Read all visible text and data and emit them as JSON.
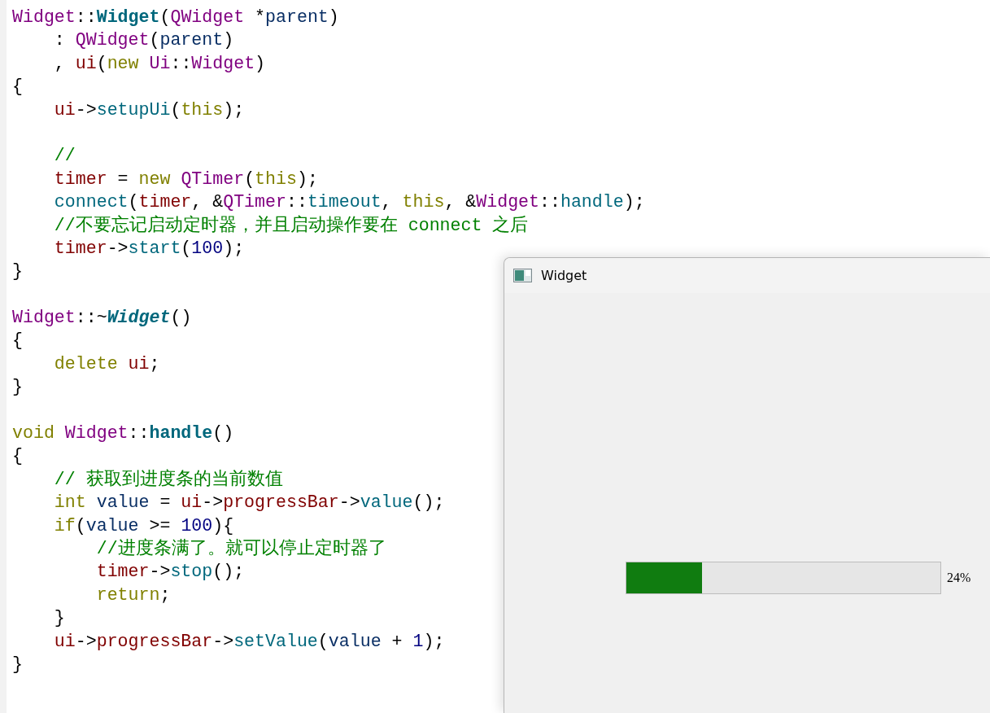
{
  "editor": {
    "lines": [
      {
        "kind": "code",
        "tokens": [
          {
            "kind": "type",
            "text": "Widget"
          },
          {
            "kind": "plain",
            "text": "::"
          },
          {
            "kind": "decl",
            "text": "Widget"
          },
          {
            "kind": "plain",
            "text": "("
          },
          {
            "kind": "type",
            "text": "QWidget"
          },
          {
            "kind": "plain",
            "text": " *"
          },
          {
            "kind": "local",
            "text": "parent"
          },
          {
            "kind": "plain",
            "text": ")"
          }
        ]
      },
      {
        "kind": "code",
        "tokens": [
          {
            "kind": "plain",
            "text": "    : "
          },
          {
            "kind": "type",
            "text": "QWidget"
          },
          {
            "kind": "plain",
            "text": "("
          },
          {
            "kind": "local",
            "text": "parent"
          },
          {
            "kind": "plain",
            "text": ")"
          }
        ]
      },
      {
        "kind": "code",
        "tokens": [
          {
            "kind": "plain",
            "text": "    , "
          },
          {
            "kind": "member",
            "text": "ui"
          },
          {
            "kind": "plain",
            "text": "("
          },
          {
            "kind": "keyword",
            "text": "new "
          },
          {
            "kind": "type",
            "text": "Ui"
          },
          {
            "kind": "plain",
            "text": "::"
          },
          {
            "kind": "type",
            "text": "Widget"
          },
          {
            "kind": "plain",
            "text": ")"
          }
        ]
      },
      {
        "kind": "code",
        "tokens": [
          {
            "kind": "plain",
            "text": "{"
          }
        ]
      },
      {
        "kind": "code",
        "tokens": [
          {
            "kind": "member",
            "text": "    ui"
          },
          {
            "kind": "plain",
            "text": "->"
          },
          {
            "kind": "func",
            "text": "setupUi"
          },
          {
            "kind": "plain",
            "text": "("
          },
          {
            "kind": "keyword",
            "text": "this"
          },
          {
            "kind": "plain",
            "text": ");"
          }
        ]
      },
      {
        "kind": "blank"
      },
      {
        "kind": "code",
        "tokens": [
          {
            "kind": "comment",
            "text": "    //"
          }
        ]
      },
      {
        "kind": "code",
        "tokens": [
          {
            "kind": "member",
            "text": "    timer"
          },
          {
            "kind": "plain",
            "text": " = "
          },
          {
            "kind": "keyword",
            "text": "new "
          },
          {
            "kind": "type",
            "text": "QTimer"
          },
          {
            "kind": "plain",
            "text": "("
          },
          {
            "kind": "keyword",
            "text": "this"
          },
          {
            "kind": "plain",
            "text": ");"
          }
        ]
      },
      {
        "kind": "code",
        "tokens": [
          {
            "kind": "func",
            "text": "    connect"
          },
          {
            "kind": "plain",
            "text": "("
          },
          {
            "kind": "member",
            "text": "timer"
          },
          {
            "kind": "plain",
            "text": ", &"
          },
          {
            "kind": "type",
            "text": "QTimer"
          },
          {
            "kind": "plain",
            "text": "::"
          },
          {
            "kind": "func",
            "text": "timeout"
          },
          {
            "kind": "plain",
            "text": ", "
          },
          {
            "kind": "keyword",
            "text": "this"
          },
          {
            "kind": "plain",
            "text": ", &"
          },
          {
            "kind": "type",
            "text": "Widget"
          },
          {
            "kind": "plain",
            "text": "::"
          },
          {
            "kind": "func",
            "text": "handle"
          },
          {
            "kind": "plain",
            "text": ");"
          }
        ]
      },
      {
        "kind": "code",
        "tokens": [
          {
            "kind": "comment",
            "text": "    //不要忘记启动定时器，并且启动操作要在 connect 之后"
          }
        ]
      },
      {
        "kind": "code",
        "tokens": [
          {
            "kind": "member",
            "text": "    timer"
          },
          {
            "kind": "plain",
            "text": "->"
          },
          {
            "kind": "func",
            "text": "start"
          },
          {
            "kind": "plain",
            "text": "("
          },
          {
            "kind": "number",
            "text": "100"
          },
          {
            "kind": "plain",
            "text": ");"
          }
        ]
      },
      {
        "kind": "code",
        "tokens": [
          {
            "kind": "plain",
            "text": "}"
          }
        ]
      },
      {
        "kind": "blank"
      },
      {
        "kind": "code",
        "tokens": [
          {
            "kind": "type",
            "text": "Widget"
          },
          {
            "kind": "plain",
            "text": "::~"
          },
          {
            "kind": "decl_italic",
            "text": "Widget"
          },
          {
            "kind": "plain",
            "text": "()"
          }
        ]
      },
      {
        "kind": "code",
        "tokens": [
          {
            "kind": "plain",
            "text": "{"
          }
        ]
      },
      {
        "kind": "code",
        "tokens": [
          {
            "kind": "keyword",
            "text": "    delete "
          },
          {
            "kind": "member",
            "text": "ui"
          },
          {
            "kind": "plain",
            "text": ";"
          }
        ]
      },
      {
        "kind": "code",
        "tokens": [
          {
            "kind": "plain",
            "text": "}"
          }
        ]
      },
      {
        "kind": "blank"
      },
      {
        "kind": "code",
        "tokens": [
          {
            "kind": "keyword",
            "text": "void "
          },
          {
            "kind": "type",
            "text": "Widget"
          },
          {
            "kind": "plain",
            "text": "::"
          },
          {
            "kind": "decl",
            "text": "handle"
          },
          {
            "kind": "plain",
            "text": "()"
          }
        ]
      },
      {
        "kind": "code",
        "tokens": [
          {
            "kind": "plain",
            "text": "{"
          }
        ]
      },
      {
        "kind": "code",
        "tokens": [
          {
            "kind": "comment",
            "text": "    // 获取到进度条的当前数值"
          }
        ]
      },
      {
        "kind": "code",
        "tokens": [
          {
            "kind": "keyword",
            "text": "    int "
          },
          {
            "kind": "local",
            "text": "value"
          },
          {
            "kind": "plain",
            "text": " = "
          },
          {
            "kind": "member",
            "text": "ui"
          },
          {
            "kind": "plain",
            "text": "->"
          },
          {
            "kind": "member",
            "text": "progressBar"
          },
          {
            "kind": "plain",
            "text": "->"
          },
          {
            "kind": "func",
            "text": "value"
          },
          {
            "kind": "plain",
            "text": "();"
          }
        ]
      },
      {
        "kind": "code",
        "tokens": [
          {
            "kind": "keyword",
            "text": "    if"
          },
          {
            "kind": "plain",
            "text": "("
          },
          {
            "kind": "local",
            "text": "value"
          },
          {
            "kind": "plain",
            "text": " >= "
          },
          {
            "kind": "number",
            "text": "100"
          },
          {
            "kind": "plain",
            "text": "){"
          }
        ]
      },
      {
        "kind": "code",
        "tokens": [
          {
            "kind": "comment",
            "text": "        //进度条满了。就可以停止定时器了"
          }
        ]
      },
      {
        "kind": "code",
        "tokens": [
          {
            "kind": "member",
            "text": "        timer"
          },
          {
            "kind": "plain",
            "text": "->"
          },
          {
            "kind": "func",
            "text": "stop"
          },
          {
            "kind": "plain",
            "text": "();"
          }
        ]
      },
      {
        "kind": "code",
        "tokens": [
          {
            "kind": "keyword",
            "text": "        return"
          },
          {
            "kind": "plain",
            "text": ";"
          }
        ]
      },
      {
        "kind": "code",
        "tokens": [
          {
            "kind": "plain",
            "text": "    }"
          }
        ]
      },
      {
        "kind": "code",
        "tokens": [
          {
            "kind": "member",
            "text": "    ui"
          },
          {
            "kind": "plain",
            "text": "->"
          },
          {
            "kind": "member",
            "text": "progressBar"
          },
          {
            "kind": "plain",
            "text": "->"
          },
          {
            "kind": "func",
            "text": "setValue"
          },
          {
            "kind": "plain",
            "text": "("
          },
          {
            "kind": "local",
            "text": "value"
          },
          {
            "kind": "plain",
            "text": " + "
          },
          {
            "kind": "number",
            "text": "1"
          },
          {
            "kind": "plain",
            "text": ");"
          }
        ]
      },
      {
        "kind": "code",
        "tokens": [
          {
            "kind": "plain",
            "text": "}"
          }
        ]
      }
    ]
  },
  "window": {
    "title": "Widget",
    "progress_bar": {
      "level": 0.24,
      "reading": "24%"
    }
  }
}
